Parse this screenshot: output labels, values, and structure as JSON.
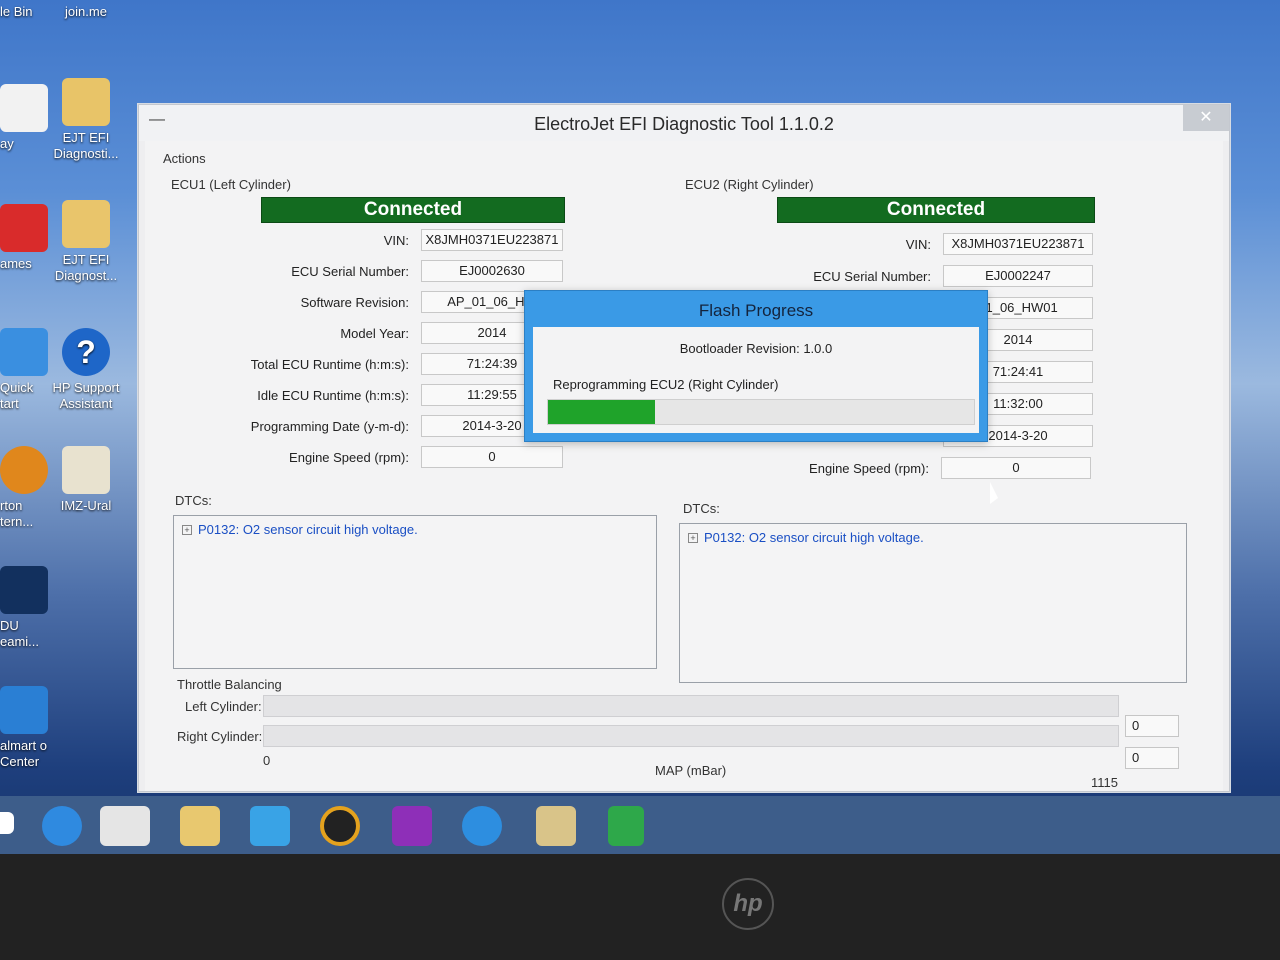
{
  "desktop": {
    "icons": [
      {
        "label": "le Bin"
      },
      {
        "label": "join.me"
      },
      {
        "label": "ay"
      },
      {
        "label": "EJT EFI Diagnosti..."
      },
      {
        "label": "ames"
      },
      {
        "label": "EJT EFI Diagnost..."
      },
      {
        "label": "Quick tart"
      },
      {
        "label": "HP Support Assistant"
      },
      {
        "label": "rton tern..."
      },
      {
        "label": "IMZ-Ural"
      },
      {
        "label": "DU eami..."
      },
      {
        "label": "almart o Center"
      }
    ]
  },
  "window": {
    "title": "ElectroJet EFI Diagnostic Tool 1.1.0.2",
    "close": "✕",
    "sysmenu": "—",
    "actions": "Actions"
  },
  "ecu1": {
    "label": "ECU1 (Left Cylinder)",
    "status": "Connected",
    "fields": [
      {
        "label": "VIN:",
        "value": "X8JMH0371EU223871"
      },
      {
        "label": "ECU Serial Number:",
        "value": "EJ0002630"
      },
      {
        "label": "Software Revision:",
        "value": "AP_01_06_HW"
      },
      {
        "label": "Model Year:",
        "value": "2014"
      },
      {
        "label": "Total ECU Runtime (h:m:s):",
        "value": "71:24:39"
      },
      {
        "label": "Idle ECU Runtime (h:m:s):",
        "value": "11:29:55"
      },
      {
        "label": "Programming Date (y-m-d):",
        "value": "2014-3-20"
      },
      {
        "label": "Engine Speed (rpm):",
        "value": "0"
      }
    ],
    "dtc_label": "DTCs:",
    "dtc_item": "P0132: O2 sensor circuit high voltage."
  },
  "ecu2": {
    "label": "ECU2 (Right Cylinder)",
    "status": "Connected",
    "fields": [
      {
        "label": "VIN:",
        "value": "X8JMH0371EU223871"
      },
      {
        "label": "ECU Serial Number:",
        "value": "EJ0002247"
      },
      {
        "label": "",
        "value": "01_06_HW01"
      },
      {
        "label": "",
        "value": "2014"
      },
      {
        "label": "",
        "value": "71:24:41"
      },
      {
        "label": "",
        "value": "11:32:00"
      },
      {
        "label": "",
        "value": "2014-3-20"
      },
      {
        "label": "Engine Speed (rpm):",
        "value": "0"
      }
    ],
    "dtc_label": "DTCs:",
    "dtc_item": "P0132: O2 sensor circuit high voltage."
  },
  "throttle": {
    "label": "Throttle Balancing",
    "left_label": "Left Cylinder:",
    "right_label": "Right Cylinder:",
    "left_value": "0",
    "right_value": "0",
    "axis_min": "0",
    "axis_max": "1115",
    "axis_label": "MAP (mBar)"
  },
  "flash": {
    "title": "Flash Progress",
    "bootloader": "Bootloader Revision: 1.0.0",
    "status": "Reprogramming ECU2 (Right Cylinder)",
    "progress": 0.25,
    "progress_color": "#1fa32a"
  },
  "colors": {
    "connected_bg": "#136b20",
    "dtc_text": "#1a4fc4",
    "modal_accent": "#3a9ae6"
  },
  "taskbar": {
    "items": [
      "internet-explorer-icon",
      "electrojet-icon",
      "file-explorer-icon",
      "rocket-icon",
      "media-player-icon",
      "puzzle-app-icon",
      "hp-icon",
      "folder-icon",
      "store-icon"
    ]
  }
}
